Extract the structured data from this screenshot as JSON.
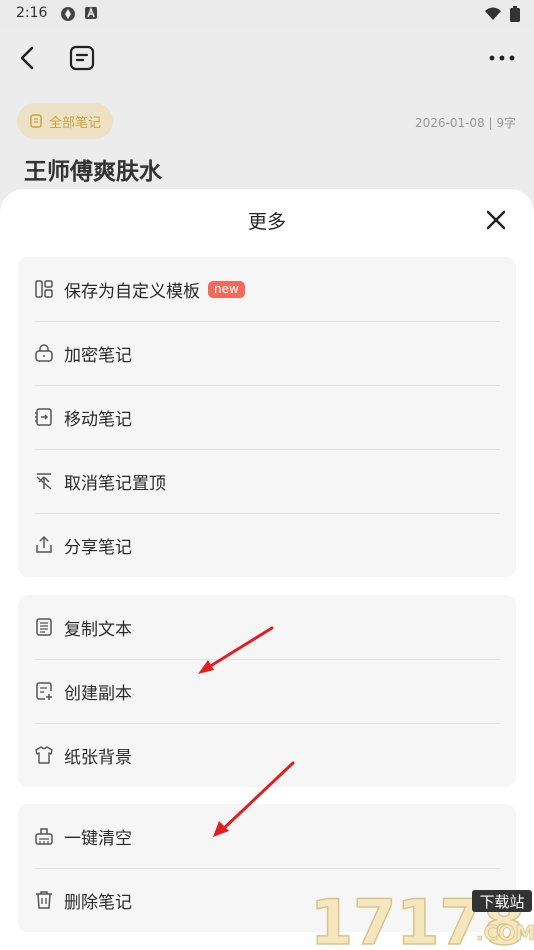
{
  "status_bar": {
    "time": "2:16"
  },
  "note": {
    "folder_label": "全部笔记",
    "meta": "2026-01-08 | 9字",
    "title": "王师傅爽肤水"
  },
  "sheet": {
    "title": "更多",
    "groups": [
      {
        "items": [
          {
            "label": "保存为自定义模板",
            "badge": "new",
            "icon": "template-icon"
          },
          {
            "label": "加密笔记",
            "icon": "lock-icon"
          },
          {
            "label": "移动笔记",
            "icon": "move-icon"
          },
          {
            "label": "取消笔记置顶",
            "icon": "unpin-icon"
          },
          {
            "label": "分享笔记",
            "icon": "share-icon"
          }
        ]
      },
      {
        "items": [
          {
            "label": "复制文本",
            "icon": "copy-text-icon"
          },
          {
            "label": "创建副本",
            "icon": "duplicate-icon"
          },
          {
            "label": "纸张背景",
            "icon": "paper-background-icon"
          }
        ]
      },
      {
        "items": [
          {
            "label": "一键清空",
            "icon": "clear-icon"
          },
          {
            "label": "删除笔记",
            "icon": "trash-icon"
          }
        ]
      }
    ]
  },
  "watermark": {
    "text": "17178",
    "sub": "下载站",
    "domain": ".COM"
  },
  "colors": {
    "accent_red": "#f26a5b",
    "arrow_red": "#e02020",
    "chip_text": "#c9a23a"
  }
}
